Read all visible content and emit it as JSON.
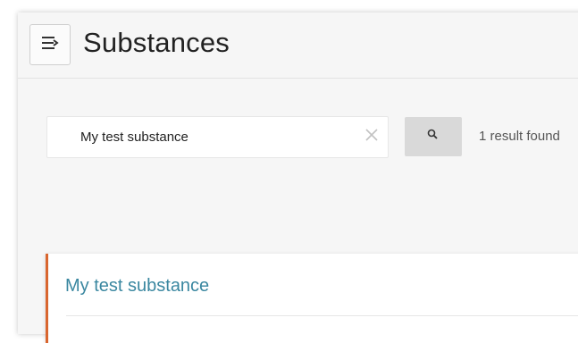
{
  "header": {
    "title": "Substances",
    "menu_icon": "menu-collapse-icon"
  },
  "search": {
    "value": "My test substance",
    "clear_icon": "close-icon",
    "button_icon": "search-icon",
    "result_count": "1 result found"
  },
  "results": [
    {
      "title": "My test substance"
    }
  ],
  "colors": {
    "accent": "#d9662f",
    "link": "#3a87a0",
    "background": "#f6f6f6"
  }
}
